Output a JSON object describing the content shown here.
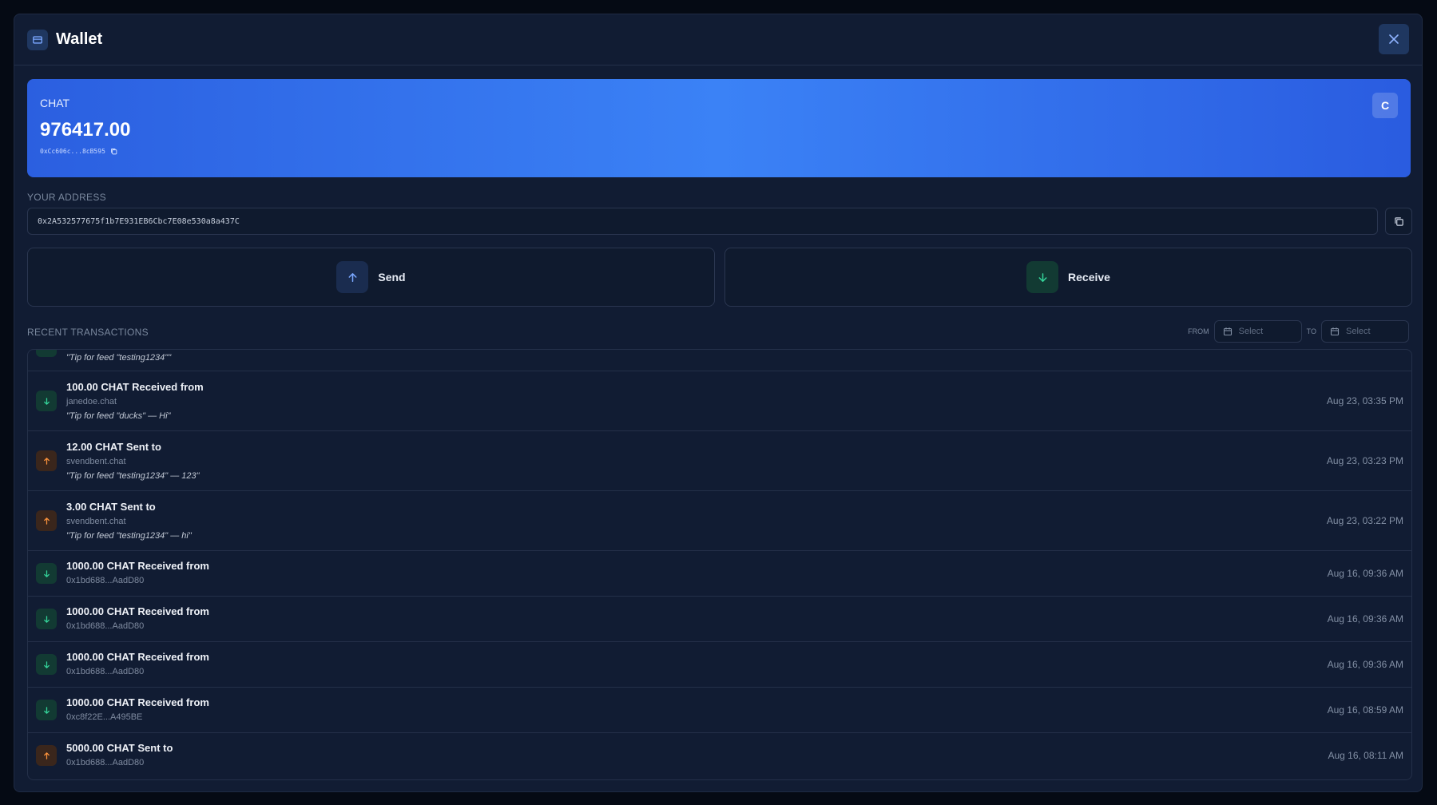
{
  "header": {
    "title": "Wallet",
    "wallet_icon": "wallet-icon",
    "close_icon": "close-icon"
  },
  "balance_card": {
    "token": "CHAT",
    "amount": "976417.00",
    "contract": "0xCc606c...8cB595",
    "avatar_letter": "C",
    "gradient_colors": [
      "#2b5fe0",
      "#3b82f6",
      "#2a5ce0"
    ]
  },
  "address": {
    "label": "YOUR ADDRESS",
    "value": "0x2A532577675f1b7E931EB6Cbc7E08e530a8a437C"
  },
  "actions": {
    "send_label": "Send",
    "receive_label": "Receive"
  },
  "transactions": {
    "label": "RECENT TRANSACTIONS",
    "from_label": "FROM",
    "to_label": "TO",
    "from_placeholder": "Select",
    "to_placeholder": "Select",
    "partial_note": "\"Tip for feed \"testing1234\"\"",
    "items": [
      {
        "direction": "in",
        "title": "100.00 CHAT Received from",
        "counterparty": "janedoe.chat",
        "note": "\"Tip for feed \"ducks\" — Hi\"",
        "time": "Aug 23, 03:35 PM"
      },
      {
        "direction": "out",
        "title": "12.00 CHAT Sent to",
        "counterparty": "svendbent.chat",
        "note": "\"Tip for feed \"testing1234\" — 123\"",
        "time": "Aug 23, 03:23 PM"
      },
      {
        "direction": "out",
        "title": "3.00 CHAT Sent to",
        "counterparty": "svendbent.chat",
        "note": "\"Tip for feed \"testing1234\" — hi\"",
        "time": "Aug 23, 03:22 PM"
      },
      {
        "direction": "in",
        "title": "1000.00 CHAT Received from",
        "counterparty": "0x1bd688...AadD80",
        "note": "",
        "time": "Aug 16, 09:36 AM"
      },
      {
        "direction": "in",
        "title": "1000.00 CHAT Received from",
        "counterparty": "0x1bd688...AadD80",
        "note": "",
        "time": "Aug 16, 09:36 AM"
      },
      {
        "direction": "in",
        "title": "1000.00 CHAT Received from",
        "counterparty": "0x1bd688...AadD80",
        "note": "",
        "time": "Aug 16, 09:36 AM"
      },
      {
        "direction": "in",
        "title": "1000.00 CHAT Received from",
        "counterparty": "0xc8f22E...A495BE",
        "note": "",
        "time": "Aug 16, 08:59 AM"
      },
      {
        "direction": "out",
        "title": "5000.00 CHAT Sent to",
        "counterparty": "0x1bd688...AadD80",
        "note": "",
        "time": "Aug 16, 08:11 AM"
      }
    ]
  },
  "colors": {
    "incoming": "#34d399",
    "outgoing": "#fb923c",
    "accent": "#3b82f6"
  }
}
